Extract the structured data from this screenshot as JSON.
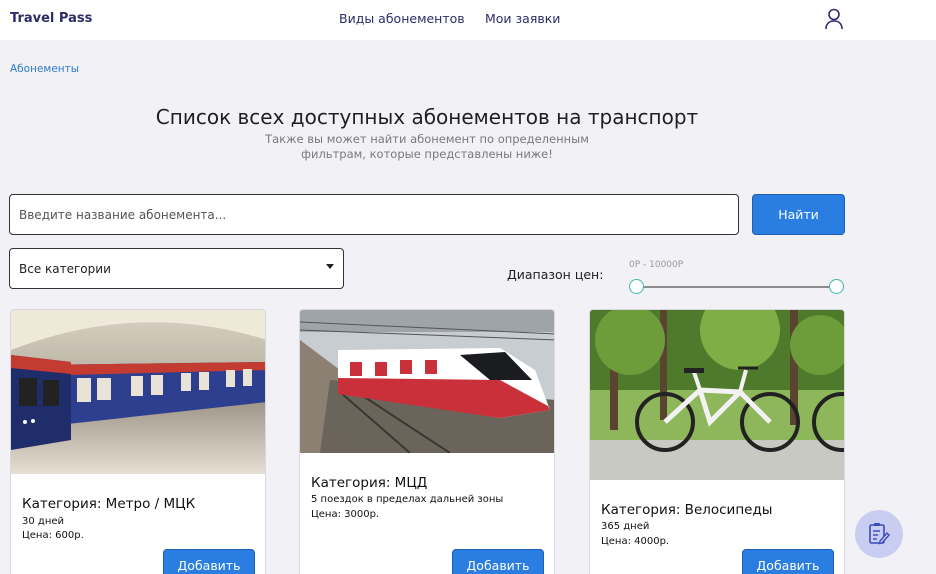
{
  "nav": {
    "brand": "Travel Pass",
    "links": [
      "Виды абонементов",
      "Мои заявки"
    ],
    "user_icon": "user-icon"
  },
  "breadcrumb": "Абонементы",
  "header": {
    "title": "Список всех доступных абонементов на транспорт",
    "subtitle": "Также вы может найти абонемент по определенным фильтрам, которые представлены ниже!"
  },
  "search": {
    "placeholder": "Введите название абонемента...",
    "value": "",
    "button_label": "Найти"
  },
  "filters": {
    "category_selected": "Все категории",
    "price_label": "Диапазон цен:",
    "price_range_text": "0Р - 10000Р",
    "price_min": 0,
    "price_max": 10000
  },
  "cards": [
    {
      "category": "Категория: Метро / МЦК",
      "description": "30 дней",
      "price": "Цена: 600р.",
      "button": "Добавить",
      "image": "metro-train"
    },
    {
      "category": "Категория: МЦД",
      "description": "5 поездок в пределах дальней зоны",
      "price": "Цена: 3000р.",
      "button": "Добавить",
      "image": "commuter-train"
    },
    {
      "category": "Категория: Велосипеды",
      "description": "365 дней",
      "price": "Цена: 4000р.",
      "button": "Добавить",
      "image": "bicycle"
    }
  ],
  "fab": {
    "icon": "notepad-edit-icon"
  },
  "colors": {
    "accent": "#2a7de1",
    "brand": "#2f2b6b",
    "background": "#f1f1f6",
    "slider": "#3fb6ad",
    "fab": "#c9cdf2"
  }
}
